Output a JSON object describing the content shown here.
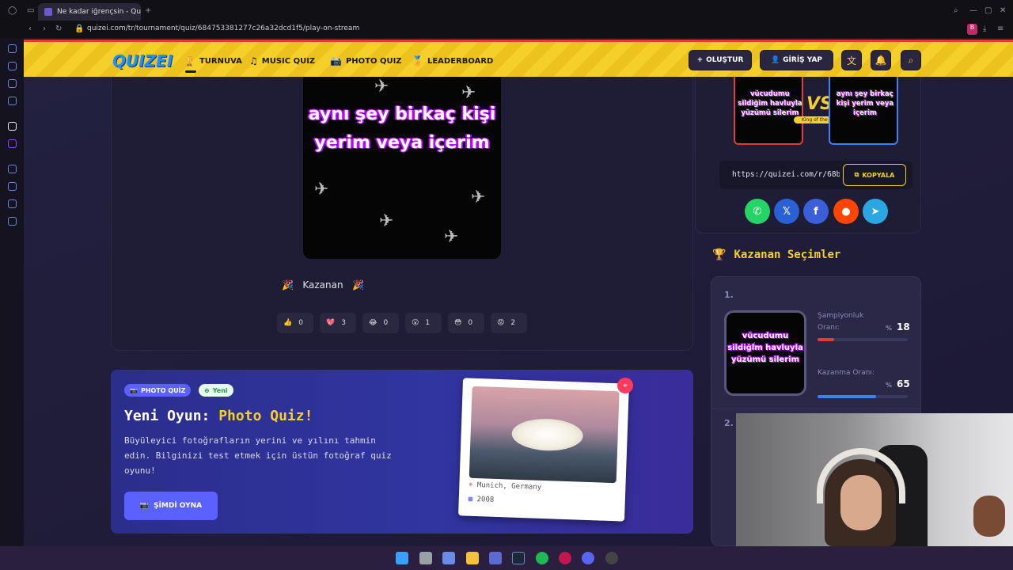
{
  "browser": {
    "tab_title": "Ne kadar iğrençsin - Quiz",
    "url": "quizei.com/tr/tournament/quiz/684753381277c26a32dcd1f5/play-on-stream",
    "new_tab": "+"
  },
  "header": {
    "logo": "QUIZEI",
    "nav": [
      {
        "label": "TURNUVA",
        "icon": "trophy-icon"
      },
      {
        "label": "MUSIC QUIZ",
        "icon": "music-icon"
      },
      {
        "label": "PHOTO QUIZ",
        "icon": "camera-icon"
      },
      {
        "label": "LEADERBOARD",
        "icon": "medal-icon"
      }
    ],
    "create_label": "OLUŞTUR",
    "login_label": "GİRİŞ YAP"
  },
  "quiz": {
    "image_text": "aynı şey birkaç kişi yerim veya içerim",
    "winner_label": "Kazanan",
    "reactions": [
      {
        "emoji": "👍",
        "count": "0"
      },
      {
        "emoji": "💖",
        "count": "3"
      },
      {
        "emoji": "😂",
        "count": "0"
      },
      {
        "emoji": "😮",
        "count": "1"
      },
      {
        "emoji": "😳",
        "count": "0"
      },
      {
        "emoji": "😡",
        "count": "2"
      }
    ]
  },
  "promo": {
    "badge": "PHOTO QUİZ",
    "new_badge": "Yeni",
    "title_prefix": "Yeni Oyun: ",
    "title_highlight": "Photo Quiz!",
    "description": "Büyüleyici fotoğrafların yerini ve yılını tahmin edin. Bilginizi test etmek için üstün fotoğraf quiz oyunu!",
    "cta": "ŞİMDİ OYNA",
    "photo_location": "Munich, Germany",
    "photo_year": "2008"
  },
  "versus": {
    "left_text": "vücudumu sildiğim havluyla yüzümü silerim",
    "right_text": "aynı şey birkaç kişi yerim veya içerim",
    "vs": "VS",
    "tag": "King of the Hill",
    "share_url": "https://quizei.com/r/68b",
    "copy_label": "KOPYALA",
    "socials": [
      {
        "name": "whatsapp",
        "glyph": "✆",
        "color": "#25d366"
      },
      {
        "name": "x",
        "glyph": "𝕏",
        "color": "#2a5fd6"
      },
      {
        "name": "facebook",
        "glyph": "f",
        "color": "#3b5fd9"
      },
      {
        "name": "reddit",
        "glyph": "●",
        "color": "#ff4500"
      },
      {
        "name": "telegram",
        "glyph": "➤",
        "color": "#2aa7e0"
      }
    ]
  },
  "winners": {
    "title": "Kazanan Seçimler",
    "items": [
      {
        "rank": "1.",
        "text": "vücudumu sildiğim havluyla yüzümü silerim",
        "champ_label": "Şampiyonluk Oranı:",
        "champ_value": "18",
        "champ_fraction": 0.18,
        "win_label": "Kazanma Oranı:",
        "win_value": "65",
        "win_fraction": 0.65,
        "percent": "%"
      },
      {
        "rank": "2."
      }
    ]
  },
  "colors": {
    "accent": "#f5cf2a",
    "primary": "#5b61ff",
    "bg": "#1f1c38"
  }
}
